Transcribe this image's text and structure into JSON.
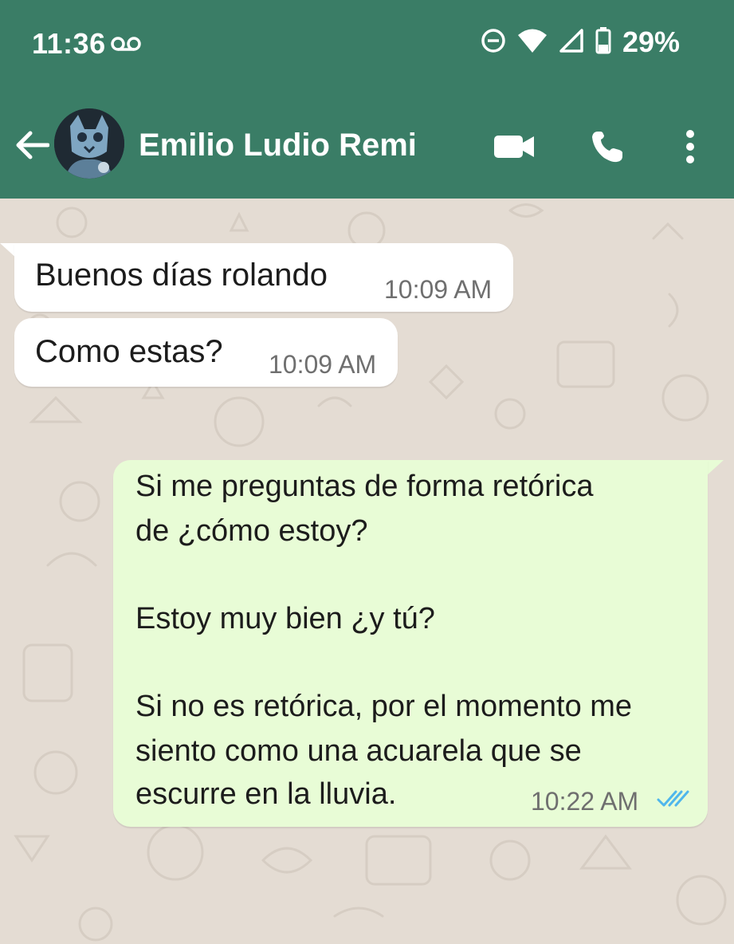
{
  "status_bar": {
    "time": "11:36",
    "battery_percent": "29%",
    "icons": [
      "voicemail-icon",
      "do-not-disturb-icon",
      "wifi-icon",
      "signal-icon",
      "battery-icon"
    ]
  },
  "header": {
    "contact_name": "Emilio Ludio Remi",
    "icons": [
      "back-arrow-icon",
      "video-call-icon",
      "phone-icon",
      "more-options-icon"
    ]
  },
  "messages": [
    {
      "direction": "incoming",
      "text": "Buenos días rolando",
      "time": "10:09 AM"
    },
    {
      "direction": "incoming",
      "text": "Como estas?",
      "time": "10:09 AM"
    },
    {
      "direction": "outgoing",
      "lines": [
        "Si me preguntas de forma retórica",
        "de ¿cómo estoy?",
        "",
        "Estoy muy bien ¿y tú?",
        "",
        "Si no es retórica, por el momento me",
        "siento como una acuarela que se",
        "escurre en la lluvia."
      ],
      "time": "10:22 AM",
      "status": "read"
    }
  ],
  "colors": {
    "header_bg": "#3a7d66",
    "chat_bg": "#e4dcd3",
    "incoming_bubble": "#ffffff",
    "outgoing_bubble": "#e8fcd6",
    "read_ticks": "#4fb6ec"
  }
}
